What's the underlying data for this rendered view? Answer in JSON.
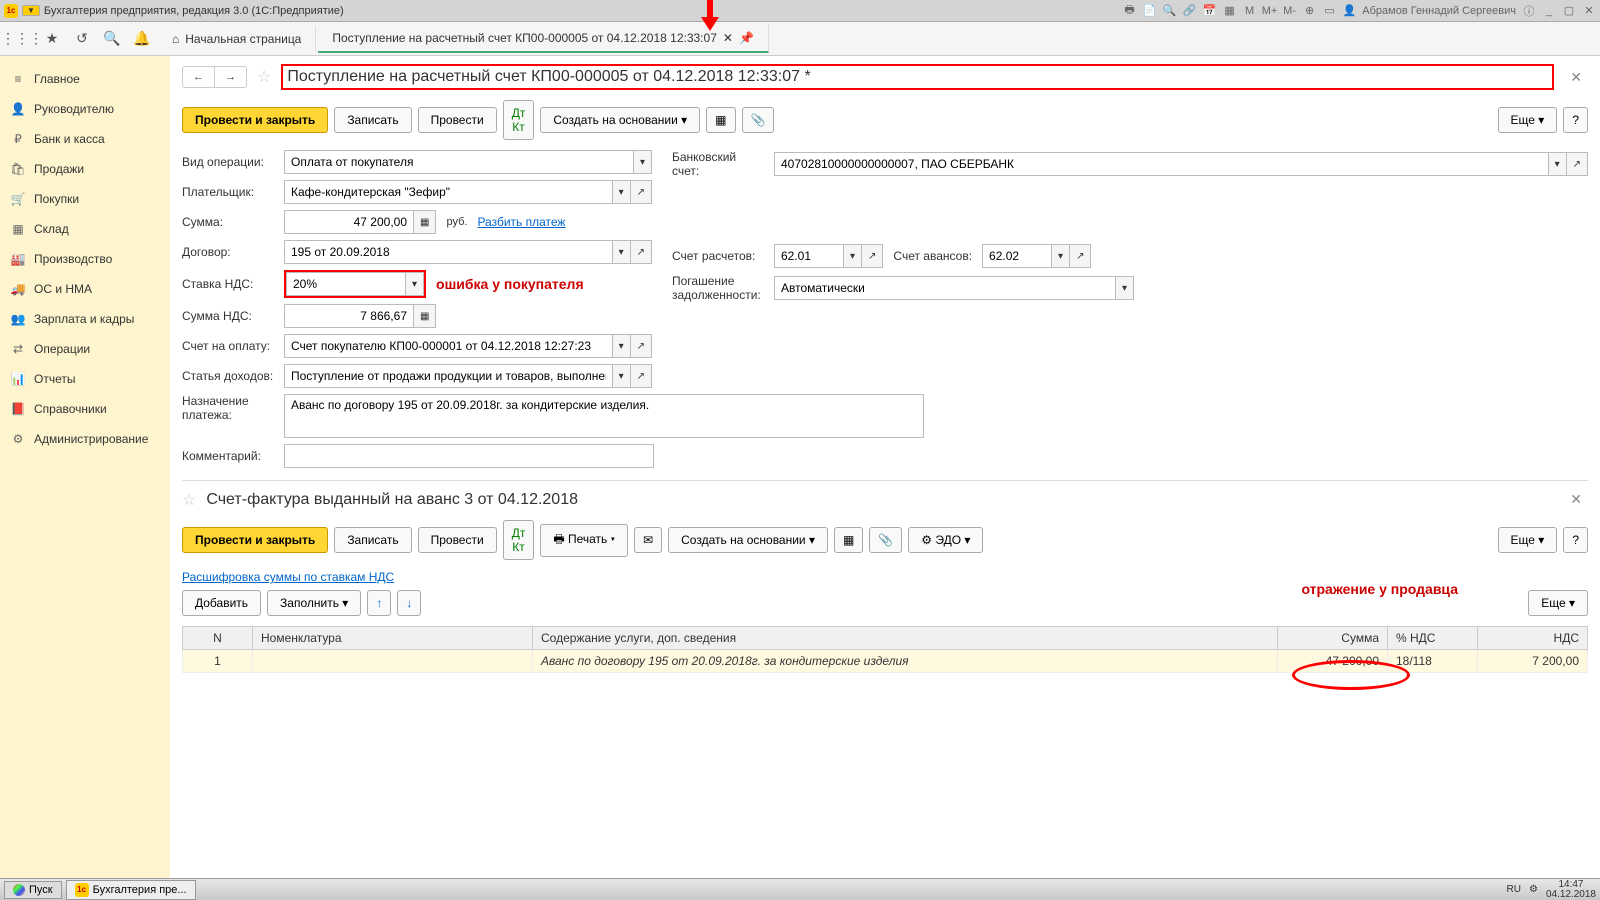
{
  "topbar": {
    "title": "Бухгалтерия предприятия, редакция 3.0  (1С:Предприятие)",
    "user": "Абрамов Геннадий Сергеевич"
  },
  "tabs": {
    "home": "Начальная страница",
    "current": "Поступление на расчетный счет КП00-000005 от 04.12.2018 12:33:07"
  },
  "sidebar": {
    "items": [
      {
        "icon": "≡",
        "label": "Главное"
      },
      {
        "icon": "👤",
        "label": "Руководителю"
      },
      {
        "icon": "₽",
        "label": "Банк и касса"
      },
      {
        "icon": "🛍",
        "label": "Продажи"
      },
      {
        "icon": "🛒",
        "label": "Покупки"
      },
      {
        "icon": "▦",
        "label": "Склад"
      },
      {
        "icon": "🏭",
        "label": "Производство"
      },
      {
        "icon": "🚚",
        "label": "ОС и НМА"
      },
      {
        "icon": "👥",
        "label": "Зарплата и кадры"
      },
      {
        "icon": "⇄",
        "label": "Операции"
      },
      {
        "icon": "📊",
        "label": "Отчеты"
      },
      {
        "icon": "📕",
        "label": "Справочники"
      },
      {
        "icon": "⚙",
        "label": "Администрирование"
      }
    ]
  },
  "doc1": {
    "title": "Поступление на расчетный счет КП00-000005 от 04.12.2018 12:33:07 *",
    "btn_post_close": "Провести и закрыть",
    "btn_save": "Записать",
    "btn_post": "Провести",
    "btn_create_base": "Создать на основании",
    "btn_more": "Еще",
    "lbl_operation": "Вид операции:",
    "val_operation": "Оплата от покупателя",
    "lbl_bank_account": "Банковский счет:",
    "val_bank_account": "40702810000000000007, ПАО СБЕРБАНК",
    "lbl_payer": "Плательщик:",
    "val_payer": "Кафе-кондитерская \"Зефир\"",
    "lbl_sum": "Сумма:",
    "val_sum": "47 200,00",
    "sum_unit": "руб.",
    "lnk_split": "Разбить платеж",
    "lbl_contract": "Договор:",
    "val_contract": "195 от 20.09.2018",
    "lbl_settle_account": "Счет расчетов:",
    "val_settle_account": "62.01",
    "lbl_advance_account": "Счет авансов:",
    "val_advance_account": "62.02",
    "lbl_vat_rate": "Ставка НДС:",
    "val_vat_rate": "20%",
    "annotation_error": "ошибка у покупателя",
    "lbl_debt": "Погашение задолженности:",
    "val_debt": "Автоматически",
    "lbl_vat_sum": "Сумма НДС:",
    "val_vat_sum": "7 866,67",
    "lbl_invoice": "Счет на оплату:",
    "val_invoice": "Счет покупателю КП00-000001 от 04.12.2018 12:27:23",
    "lbl_income": "Статья доходов:",
    "val_income": "Поступление от продажи продукции и товаров, выполнения",
    "lbl_purpose": "Назначение платежа:",
    "val_purpose": "Аванс по договору 195 от 20.09.2018г. за кондитерские изделия.",
    "lbl_comment": "Комментарий:"
  },
  "doc2": {
    "title": "Счет-фактура выданный на аванс 3 от 04.12.2018",
    "btn_post_close": "Провести и закрыть",
    "btn_save": "Записать",
    "btn_post": "Провести",
    "btn_print": "Печать",
    "btn_create_base": "Создать на основании",
    "btn_edo": "ЭДО",
    "btn_more": "Еще",
    "subtitle": "Расшифровка суммы по ставкам НДС",
    "btn_add": "Добавить",
    "btn_fill": "Заполнить",
    "annotation_seller": "отражение у продавца",
    "cols": {
      "n": "N",
      "nom": "Номенклатура",
      "desc": "Содержание услуги, доп. сведения",
      "sum": "Сумма",
      "vat_pct": "% НДС",
      "vat": "НДС"
    },
    "row": {
      "n": "1",
      "desc": "Аванс по договору 195 от 20.09.2018г. за кондитерские изделия",
      "sum": "47 200,00",
      "vat_pct": "18/118",
      "vat": "7 200,00"
    }
  },
  "taskbar": {
    "start": "Пуск",
    "app": "Бухгалтерия пре...",
    "lang": "RU",
    "time": "14:47",
    "date": "04.12.2018"
  }
}
